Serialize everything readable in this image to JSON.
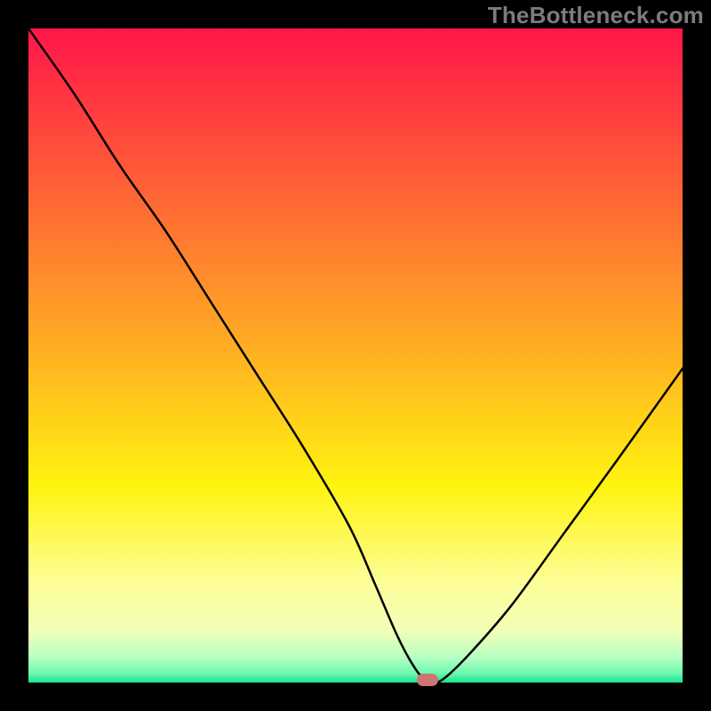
{
  "watermark": "TheBottleneck.com",
  "chart_data": {
    "type": "line",
    "title": "",
    "xlabel": "",
    "ylabel": "",
    "xlim": [
      0,
      100
    ],
    "ylim": [
      0,
      100
    ],
    "series": [
      {
        "name": "curve",
        "x": [
          0,
          7,
          14,
          21,
          28,
          35,
          42,
          49,
          53,
          56,
          58,
          60,
          62,
          64,
          68,
          74,
          82,
          90,
          100
        ],
        "values": [
          100,
          90,
          79,
          69,
          58,
          47,
          36,
          24,
          15,
          8,
          4,
          1,
          0,
          1,
          5,
          12,
          23,
          34,
          48
        ]
      }
    ],
    "gradient_stops": [
      {
        "pos": 0.0,
        "color": "#ff1549"
      },
      {
        "pos": 0.5,
        "color": "#ffb222"
      },
      {
        "pos": 0.7,
        "color": "#fff30f"
      },
      {
        "pos": 0.85,
        "color": "#fdfe9b"
      },
      {
        "pos": 0.92,
        "color": "#f3ffb7"
      },
      {
        "pos": 0.96,
        "color": "#b9ffc2"
      },
      {
        "pos": 0.985,
        "color": "#70f9b1"
      },
      {
        "pos": 1.0,
        "color": "#17e48d"
      }
    ],
    "marker": {
      "x": 61,
      "y": 0,
      "color": "#cd7571"
    },
    "curve_color": "#000000",
    "curve_width": 2.5
  }
}
